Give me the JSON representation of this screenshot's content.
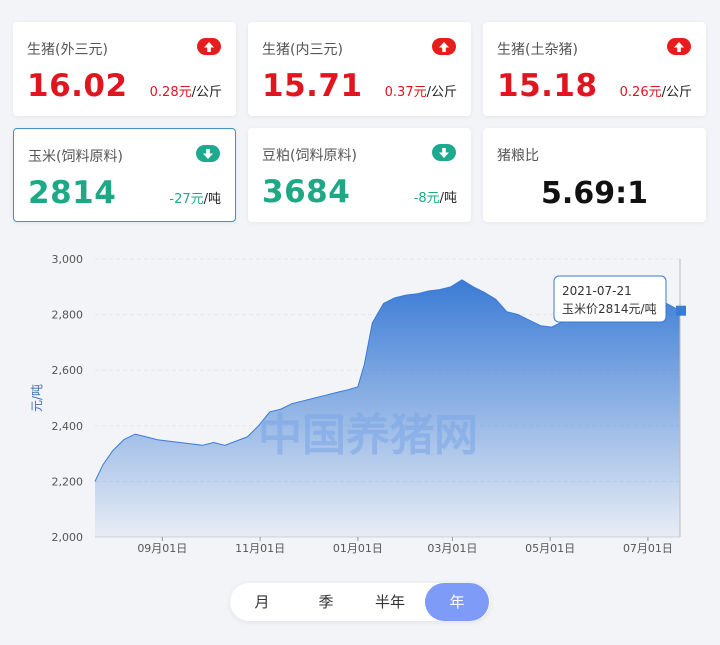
{
  "cards": [
    {
      "title": "生猪(外三元)",
      "price": "16.02",
      "change_value": "0.28元",
      "change_unit": "/公斤",
      "direction": "up"
    },
    {
      "title": "生猪(内三元)",
      "price": "15.71",
      "change_value": "0.37元",
      "change_unit": "/公斤",
      "direction": "up"
    },
    {
      "title": "生猪(土杂猪)",
      "price": "15.18",
      "change_value": "0.26元",
      "change_unit": "/公斤",
      "direction": "up"
    },
    {
      "title": "玉米(饲料原料)",
      "price": "2814",
      "change_value": "-27元",
      "change_unit": "/吨",
      "direction": "down"
    },
    {
      "title": "豆粕(饲料原料)",
      "price": "3684",
      "change_value": "-8元",
      "change_unit": "/吨",
      "direction": "down"
    },
    {
      "title": "猪粮比",
      "ratio": "5.69:1"
    }
  ],
  "colors": {
    "up": "#e81c1c",
    "down": "#1eaa8e",
    "chart_line": "#3a7bd5",
    "accent": "#7e9bf7"
  },
  "chart_data": {
    "type": "area",
    "ylabel": "元/吨",
    "ylim": [
      2000,
      3000
    ],
    "yticks": [
      "2,000",
      "2,200",
      "2,400",
      "2,600",
      "2,800",
      "3,000"
    ],
    "ytick_values": [
      2000,
      2200,
      2400,
      2600,
      2800,
      3000
    ],
    "xticks": [
      "09月01日",
      "11月01日",
      "01月01日",
      "03月01日",
      "05月01日",
      "07月01日"
    ],
    "xtick_dates": [
      "2020-09-01",
      "2020-11-01",
      "2021-01-01",
      "2021-03-01",
      "2021-05-01",
      "2021-07-01"
    ],
    "grid": true,
    "watermark": "中国养猪网",
    "series": [
      {
        "x": [
          "2020-07-21",
          "2020-07-26",
          "2020-08-01",
          "2020-08-08",
          "2020-08-15",
          "2020-08-22",
          "2020-08-29",
          "2020-09-05",
          "2020-09-12",
          "2020-09-19",
          "2020-09-26",
          "2020-10-03",
          "2020-10-10",
          "2020-10-17",
          "2020-10-24",
          "2020-10-31",
          "2020-11-07",
          "2020-11-14",
          "2020-11-21",
          "2020-11-28",
          "2020-12-05",
          "2020-12-12",
          "2020-12-19",
          "2020-12-26",
          "2021-01-01",
          "2021-01-05",
          "2021-01-10",
          "2021-01-17",
          "2021-01-24",
          "2021-01-31",
          "2021-02-07",
          "2021-02-14",
          "2021-02-21",
          "2021-02-28",
          "2021-03-07",
          "2021-03-14",
          "2021-03-21",
          "2021-03-28",
          "2021-04-04",
          "2021-04-11",
          "2021-04-18",
          "2021-04-25",
          "2021-05-02",
          "2021-05-09",
          "2021-05-16",
          "2021-05-23",
          "2021-05-30",
          "2021-06-06",
          "2021-06-13",
          "2021-06-20",
          "2021-06-27",
          "2021-07-04",
          "2021-07-11",
          "2021-07-21"
        ],
        "values": [
          2200,
          2260,
          2310,
          2350,
          2370,
          2360,
          2350,
          2345,
          2340,
          2335,
          2330,
          2340,
          2330,
          2345,
          2360,
          2400,
          2450,
          2460,
          2480,
          2490,
          2500,
          2510,
          2520,
          2530,
          2540,
          2620,
          2770,
          2840,
          2860,
          2870,
          2875,
          2885,
          2890,
          2900,
          2925,
          2900,
          2880,
          2855,
          2810,
          2800,
          2780,
          2760,
          2755,
          2775,
          2790,
          2800,
          2810,
          2790,
          2810,
          2830,
          2835,
          2840,
          2845,
          2814
        ]
      }
    ],
    "tooltip": {
      "date": "2021-07-21",
      "text": "玉米价2814元/吨"
    }
  },
  "segments": [
    {
      "label": "月",
      "active": false
    },
    {
      "label": "季",
      "active": false
    },
    {
      "label": "半年",
      "active": false
    },
    {
      "label": "年",
      "active": true
    }
  ]
}
